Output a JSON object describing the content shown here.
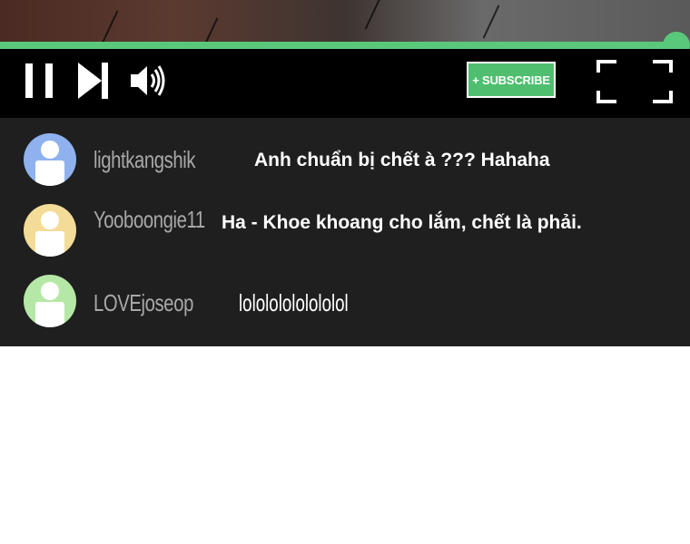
{
  "player": {
    "progress_fraction": 0.98,
    "accent_color": "#5ac87a",
    "controls": {
      "pause_icon": "pause-icon",
      "next_icon": "skip-next-icon",
      "volume_icon": "volume-icon",
      "fullscreen_icon": "fullscreen-icon"
    },
    "subscribe_label": "+ SUBSCRIBE"
  },
  "chat": {
    "messages": [
      {
        "username": "lightkangshik",
        "text": "Anh chuẩn bị chết à ??? Hahaha",
        "avatar_color": "#8fb2ee"
      },
      {
        "username": "Yooboongie11",
        "text": "Ha - Khoe khoang cho lắm, chết là phải.",
        "avatar_color": "#f3dc98"
      },
      {
        "username": "LOVEjoseop",
        "text": "lolololololololol",
        "avatar_color": "#b5e8a6"
      }
    ]
  }
}
